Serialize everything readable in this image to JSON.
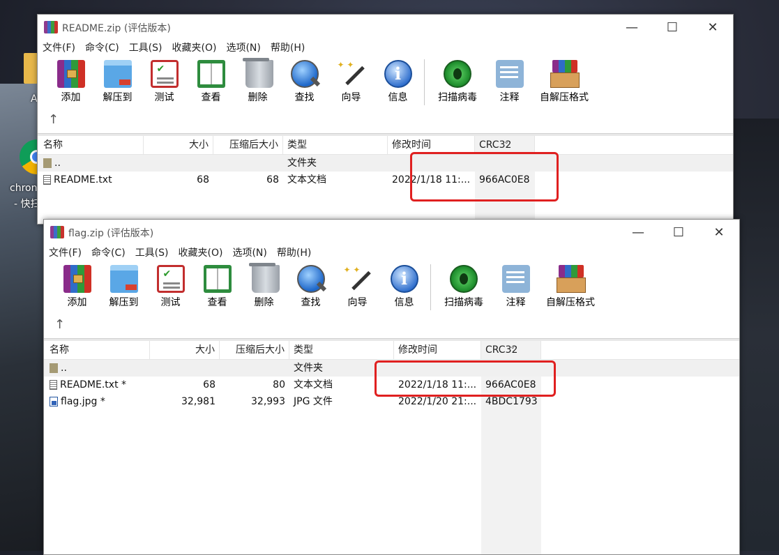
{
  "desktop": {
    "icon_partial_label": "A",
    "chrome_label_line1": "chron",
    "chrome_label_line2": "- 快扫"
  },
  "window1": {
    "title": "README.zip (评估版本)",
    "menus": [
      "文件(F)",
      "命令(C)",
      "工具(S)",
      "收藏夹(O)",
      "选项(N)",
      "帮助(H)"
    ],
    "tools": [
      {
        "label": "添加",
        "icon": "add-icon"
      },
      {
        "label": "解压到",
        "icon": "extract-icon"
      },
      {
        "label": "测试",
        "icon": "test-icon"
      },
      {
        "label": "查看",
        "icon": "view-icon"
      },
      {
        "label": "删除",
        "icon": "delete-icon"
      },
      {
        "label": "查找",
        "icon": "find-icon"
      },
      {
        "label": "向导",
        "icon": "wizard-icon"
      },
      {
        "label": "信息",
        "icon": "info-icon"
      },
      {
        "label": "扫描病毒",
        "icon": "virus-scan-icon"
      },
      {
        "label": "注释",
        "icon": "comment-icon"
      },
      {
        "label": "自解压格式",
        "icon": "sfx-icon"
      }
    ],
    "columns": [
      "名称",
      "大小",
      "压缩后大小",
      "类型",
      "修改时间",
      "CRC32"
    ],
    "rows": [
      {
        "name": "..",
        "size": "",
        "packed": "",
        "type": "文件夹",
        "modified": "",
        "crc": ""
      },
      {
        "name": "README.txt",
        "size": "68",
        "packed": "68",
        "type": "文本文档",
        "modified": "2022/1/18 11:...",
        "crc": "966AC0E8"
      }
    ]
  },
  "window2": {
    "title": "flag.zip (评估版本)",
    "menus": [
      "文件(F)",
      "命令(C)",
      "工具(S)",
      "收藏夹(O)",
      "选项(N)",
      "帮助(H)"
    ],
    "tools": [
      {
        "label": "添加",
        "icon": "add-icon"
      },
      {
        "label": "解压到",
        "icon": "extract-icon"
      },
      {
        "label": "测试",
        "icon": "test-icon"
      },
      {
        "label": "查看",
        "icon": "view-icon"
      },
      {
        "label": "删除",
        "icon": "delete-icon"
      },
      {
        "label": "查找",
        "icon": "find-icon"
      },
      {
        "label": "向导",
        "icon": "wizard-icon"
      },
      {
        "label": "信息",
        "icon": "info-icon"
      },
      {
        "label": "扫描病毒",
        "icon": "virus-scan-icon"
      },
      {
        "label": "注释",
        "icon": "comment-icon"
      },
      {
        "label": "自解压格式",
        "icon": "sfx-icon"
      }
    ],
    "columns": [
      "名称",
      "大小",
      "压缩后大小",
      "类型",
      "修改时间",
      "CRC32"
    ],
    "rows": [
      {
        "name": "..",
        "size": "",
        "packed": "",
        "type": "文件夹",
        "modified": "",
        "crc": ""
      },
      {
        "name": "README.txt *",
        "size": "68",
        "packed": "80",
        "type": "文本文档",
        "modified": "2022/1/18 11:...",
        "crc": "966AC0E8"
      },
      {
        "name": "flag.jpg *",
        "size": "32,981",
        "packed": "32,993",
        "type": "JPG 文件",
        "modified": "2022/1/20 21:...",
        "crc": "4BDC1793"
      }
    ]
  },
  "window_buttons": {
    "minimize": "—",
    "maximize": "☐",
    "close": "✕"
  },
  "up_arrow": "↑",
  "highlight_color": "#e02020"
}
